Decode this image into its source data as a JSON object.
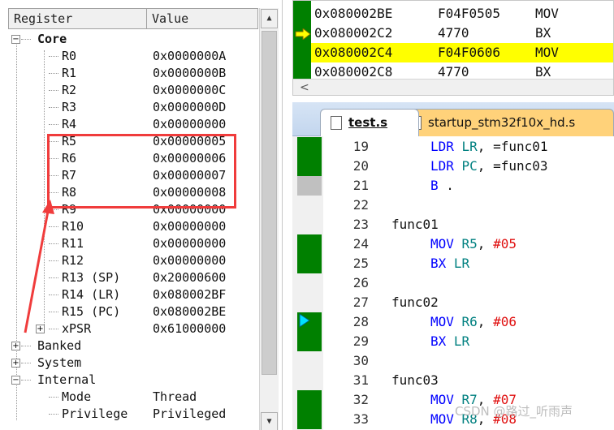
{
  "registers": {
    "col_name": "Register",
    "col_value": "Value",
    "groups": {
      "core": "Core",
      "banked": "Banked",
      "system": "System",
      "internal": "Internal"
    },
    "core": [
      {
        "name": "R0",
        "value": "0x0000000A"
      },
      {
        "name": "R1",
        "value": "0x0000000B"
      },
      {
        "name": "R2",
        "value": "0x0000000C"
      },
      {
        "name": "R3",
        "value": "0x0000000D"
      },
      {
        "name": "R4",
        "value": "0x00000000"
      },
      {
        "name": "R5",
        "value": "0x00000005"
      },
      {
        "name": "R6",
        "value": "0x00000006"
      },
      {
        "name": "R7",
        "value": "0x00000007"
      },
      {
        "name": "R8",
        "value": "0x00000008"
      },
      {
        "name": "R9",
        "value": "0x00000000"
      },
      {
        "name": "R10",
        "value": "0x00000000"
      },
      {
        "name": "R11",
        "value": "0x00000000"
      },
      {
        "name": "R12",
        "value": "0x00000000"
      },
      {
        "name": "R13 (SP)",
        "value": "0x20000600"
      },
      {
        "name": "R14 (LR)",
        "value": "0x080002BF"
      },
      {
        "name": "R15 (PC)",
        "value": "0x080002BE"
      },
      {
        "name": "xPSR",
        "value": "0x61000000"
      }
    ],
    "internal": [
      {
        "name": "Mode",
        "value": "Thread"
      },
      {
        "name": "Privilege",
        "value": "Privileged"
      }
    ],
    "expander_collapsed": "+",
    "expander_expanded": "−"
  },
  "disassembly": {
    "lines": [
      {
        "addr": "0x080002BE",
        "hex": "F04F0505",
        "op": "MOV"
      },
      {
        "addr": "0x080002C2",
        "hex": "4770",
        "op": "BX"
      },
      {
        "addr": "0x080002C4",
        "hex": "F04F0606",
        "op": "MOV"
      },
      {
        "addr": "0x080002C8",
        "hex": "4770",
        "op": "BX"
      }
    ],
    "scroll_left": "<"
  },
  "tabs": [
    {
      "label": "test.s",
      "active": true
    },
    {
      "label": "startup_stm32f10x_hd.s",
      "active": false
    }
  ],
  "code": [
    {
      "ln": "19",
      "parts": [
        [
          "kw",
          "LDR "
        ],
        [
          "reg",
          "LR"
        ],
        [
          "lbl",
          ", =func01"
        ]
      ],
      "indent": true
    },
    {
      "ln": "20",
      "parts": [
        [
          "kw",
          "LDR "
        ],
        [
          "reg",
          "PC"
        ],
        [
          "lbl",
          ", =func03"
        ]
      ],
      "indent": true
    },
    {
      "ln": "21",
      "parts": [
        [
          "kw",
          "B"
        ],
        [
          "lbl",
          " ."
        ]
      ],
      "indent": true
    },
    {
      "ln": "22",
      "parts": [],
      "indent": false
    },
    {
      "ln": "23",
      "parts": [
        [
          "lbl",
          "func01"
        ]
      ],
      "indent": false
    },
    {
      "ln": "24",
      "parts": [
        [
          "kw",
          "MOV "
        ],
        [
          "reg",
          "R5"
        ],
        [
          "lbl",
          ", "
        ],
        [
          "num",
          "#05"
        ]
      ],
      "indent": true
    },
    {
      "ln": "25",
      "parts": [
        [
          "kw",
          "BX "
        ],
        [
          "reg",
          "LR"
        ]
      ],
      "indent": true
    },
    {
      "ln": "26",
      "parts": [],
      "indent": false
    },
    {
      "ln": "27",
      "parts": [
        [
          "lbl",
          "func02"
        ]
      ],
      "indent": false
    },
    {
      "ln": "28",
      "parts": [
        [
          "kw",
          "MOV "
        ],
        [
          "reg",
          "R6"
        ],
        [
          "lbl",
          ", "
        ],
        [
          "num",
          "#06"
        ]
      ],
      "indent": true
    },
    {
      "ln": "29",
      "parts": [
        [
          "kw",
          "BX "
        ],
        [
          "reg",
          "LR"
        ]
      ],
      "indent": true
    },
    {
      "ln": "30",
      "parts": [],
      "indent": false
    },
    {
      "ln": "31",
      "parts": [
        [
          "lbl",
          "func03"
        ]
      ],
      "indent": false
    },
    {
      "ln": "32",
      "parts": [
        [
          "kw",
          "MOV "
        ],
        [
          "reg",
          "R7"
        ],
        [
          "lbl",
          ", "
        ],
        [
          "num",
          "#07"
        ]
      ],
      "indent": true
    },
    {
      "ln": "33",
      "parts": [
        [
          "kw",
          "MOV "
        ],
        [
          "reg",
          "R8"
        ],
        [
          "lbl",
          ", "
        ],
        [
          "num",
          "#08"
        ]
      ],
      "indent": true
    }
  ],
  "watermark": "CSDN @路过_听雨声",
  "colors": {
    "gutter_green": "#008000",
    "gutter_gray": "#c0c0c0",
    "current_line": "#ffff00",
    "highlight_red": "#f03c3c",
    "keyword": "#0000ff",
    "register": "#008080",
    "number": "#e01010"
  }
}
